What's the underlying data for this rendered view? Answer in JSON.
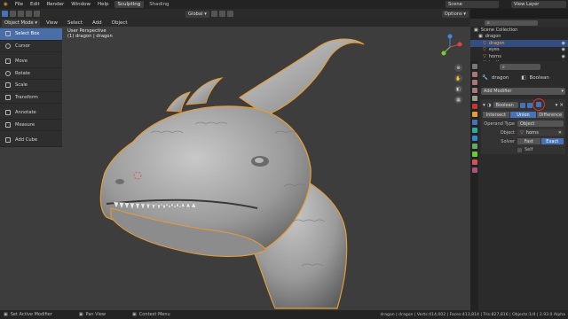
{
  "menubar": {
    "items": [
      "File",
      "Edit",
      "Render",
      "Window",
      "Help"
    ],
    "workspaces": [
      "Sculpting",
      "Shading"
    ],
    "scene": "Scene",
    "view_layer": "View Layer"
  },
  "toolbar": {
    "mode": "Object Mode",
    "menus": [
      "View",
      "Select",
      "Add",
      "Object"
    ],
    "transform": "Global",
    "options": "Options"
  },
  "viewport": {
    "perspective": "User Perspective",
    "object": "(1) dragon | dragon"
  },
  "tools": [
    "Select Box",
    "Cursor",
    "Move",
    "Rotate",
    "Scale",
    "Transform",
    "Annotate",
    "Measure",
    "Add Cube"
  ],
  "outliner": {
    "title": "Scene Collection",
    "items": [
      "dragon",
      "dragon",
      "eyes",
      "horns",
      "teeth"
    ]
  },
  "properties": {
    "object": "dragon",
    "modifier_name": "Boolean",
    "add_modifier": "Add Modifier",
    "mod_label": "Boolean",
    "ops": [
      "Intersect",
      "Union",
      "Difference"
    ],
    "operand_type_label": "Operand Type",
    "operand_type": "Object",
    "object_label": "Object",
    "object_value": "horns",
    "solver_label": "Solver",
    "solvers": [
      "Fast",
      "Exact"
    ],
    "self_label": "Self"
  },
  "statusbar": {
    "left": "Set Active Modifier",
    "mid": "Pan View",
    "right": "Context Menu",
    "stats": "dragon | dragon | Verts:414,002 | Faces:413,814 | Tris:827,816 | Objects:1/4 | 2.93.0 Alpha"
  },
  "colors": {
    "accent": "#4772b3",
    "selection_outline": "#e39c3a",
    "annotation_circle": "#e0322a"
  }
}
